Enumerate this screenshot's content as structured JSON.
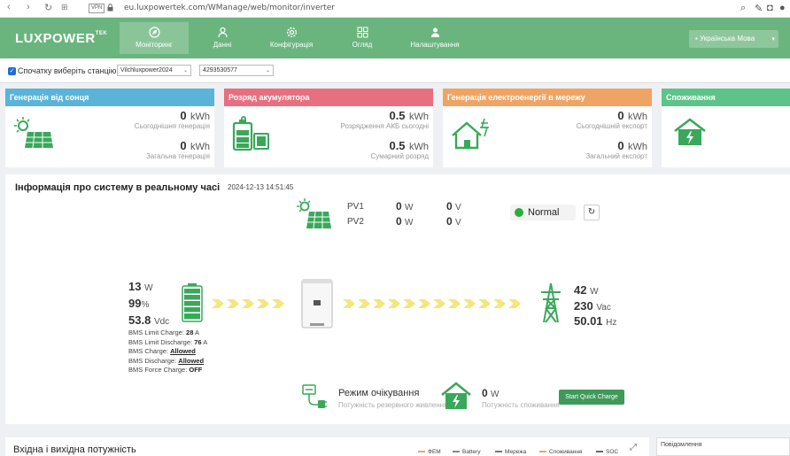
{
  "browser": {
    "vpn": "VPN",
    "url": "eu.luxpowertek.com/WManage/web/monitor/inverter"
  },
  "nav": {
    "logo": "LUXPOWER",
    "logo_sup": "TEK",
    "items": [
      {
        "label": "Моніторинг",
        "icon": "compass-icon",
        "active": true
      },
      {
        "label": "Данні",
        "icon": "person-icon",
        "active": false
      },
      {
        "label": "Конфігурація",
        "icon": "gear-icon",
        "active": false
      },
      {
        "label": "Огляд",
        "icon": "grid-icon",
        "active": false
      },
      {
        "label": "Налаштування",
        "icon": "user-icon",
        "active": false
      }
    ],
    "language": "Українська Мова"
  },
  "station": {
    "checkbox_label": "Спочатку виберіть станцію",
    "station_value": "Vilchluxpower2024",
    "serial_value": "4293530577"
  },
  "cards": [
    {
      "title": "Генерація від сонця",
      "color": "#5bb4d8",
      "icon": "solar-panel-icon",
      "rows": [
        {
          "value": "0",
          "unit": "kWh",
          "label": "Сьогоднішня генерація"
        },
        {
          "value": "0",
          "unit": "kWh",
          "label": "Загальна генерація"
        }
      ]
    },
    {
      "title": "Розряд акумулятора",
      "color": "#e86f80",
      "icon": "battery-icon",
      "rows": [
        {
          "value": "0.5",
          "unit": "kWh",
          "label": "Розрядження АКБ сьогодні"
        },
        {
          "value": "0.5",
          "unit": "kWh",
          "label": "Сумарний розряд"
        }
      ]
    },
    {
      "title": "Генерація електроенергії в мережу",
      "color": "#f0a464",
      "icon": "house-grid-icon",
      "rows": [
        {
          "value": "0",
          "unit": "kWh",
          "label": "Сьогоднішній експорт"
        },
        {
          "value": "0",
          "unit": "kWh",
          "label": "Загальний експорт"
        }
      ]
    },
    {
      "title": "Споживання",
      "color": "#5ec38a",
      "icon": "home-bolt-icon",
      "rows": []
    }
  ],
  "realtime": {
    "title": "Інформація про систему в реальному часі",
    "timestamp": "2024-12-13 14:51:45",
    "pv1": {
      "label": "PV1",
      "power": "0",
      "power_unit": "W",
      "voltage": "0",
      "voltage_unit": "V"
    },
    "pv2": {
      "label": "PV2",
      "power": "0",
      "power_unit": "W",
      "voltage": "0",
      "voltage_unit": "V"
    },
    "status": "Normal",
    "status_color": "#27ae3c",
    "battery": {
      "power": "13",
      "power_unit": "W",
      "soc": "99",
      "soc_unit": "%",
      "voltage": "53.8",
      "voltage_unit": "Vdc"
    },
    "bms": [
      {
        "label": "BMS Limit Charge:",
        "value": "28",
        "unit": "A"
      },
      {
        "label": "BMS Limit Discharge:",
        "value": "76",
        "unit": "A"
      },
      {
        "label": "BMS Charge:",
        "value": "Allowed",
        "unit": ""
      },
      {
        "label": "BMS Discharge:",
        "value": "Allowed",
        "unit": ""
      },
      {
        "label": "BMS Force Charge:",
        "value": "OFF",
        "unit": ""
      }
    ],
    "grid": {
      "power": "42",
      "power_unit": "W",
      "voltage": "230",
      "voltage_unit": "Vac",
      "freq": "50.01",
      "freq_unit": "Hz"
    },
    "standby_title": "Режим очікування",
    "standby_sub": "Потужність резервного живлення(ЕPS)",
    "consumption_value": "0",
    "consumption_unit": "W",
    "consumption_label": "Потужність споживання",
    "quick_charge": "Start Quick Charge",
    "flow_color": "#f5e57a"
  },
  "bottom": {
    "title": "Вхідна і вихідна потужність",
    "legend": [
      {
        "label": "ФЕМ",
        "color": "#f0a464"
      },
      {
        "label": "Battery",
        "color": "#888888"
      },
      {
        "label": "Мережа",
        "color": "#777777"
      },
      {
        "label": "Споживання",
        "color": "#f0a464"
      },
      {
        "label": "SOC",
        "color": "#666666"
      }
    ],
    "notices": "Повідомлення"
  }
}
